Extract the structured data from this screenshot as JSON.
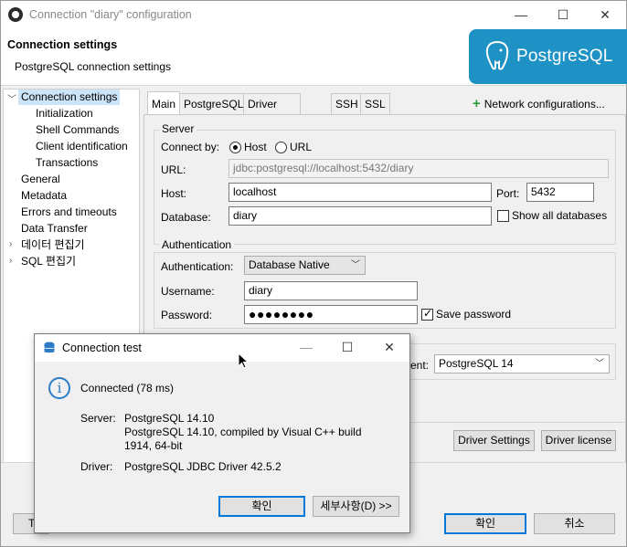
{
  "window": {
    "title": "Connection \"diary\" configuration",
    "minimize": "—",
    "maximize": "☐",
    "close": "✕"
  },
  "header": {
    "title": "Connection settings",
    "subtitle": "PostgreSQL connection settings",
    "logo_text": "PostgreSQL"
  },
  "tree": {
    "items": [
      {
        "label": "Connection settings",
        "expanded": true,
        "selected": true
      },
      {
        "label": "Initialization"
      },
      {
        "label": "Shell Commands"
      },
      {
        "label": "Client identification"
      },
      {
        "label": "Transactions"
      },
      {
        "label": "General"
      },
      {
        "label": "Metadata"
      },
      {
        "label": "Errors and timeouts"
      },
      {
        "label": "Data Transfer"
      },
      {
        "label": "데이터 편집기",
        "collapsed": true
      },
      {
        "label": "SQL 편집기",
        "collapsed": true
      }
    ]
  },
  "tabs": [
    "Main",
    "PostgreSQL",
    "Driver properties",
    "SSH",
    "SSL"
  ],
  "network_config": "Network configurations...",
  "server": {
    "group_label": "Server",
    "connect_by_label": "Connect by:",
    "host_option": "Host",
    "url_option": "URL",
    "url_label": "URL:",
    "url_value": "jdbc:postgresql://localhost:5432/diary",
    "host_label": "Host:",
    "host_value": "localhost",
    "port_label": "Port:",
    "port_value": "5432",
    "database_label": "Database:",
    "database_value": "diary",
    "show_all_label": "Show all databases"
  },
  "auth": {
    "group_label": "Authentication",
    "auth_label": "Authentication:",
    "auth_value": "Database Native",
    "username_label": "Username:",
    "username_value": "diary",
    "password_label": "Password:",
    "password_value": "●●●●●●●●",
    "save_password_label": "Save password"
  },
  "driver": {
    "client_label_fragment": "ent:",
    "client_value": "PostgreSQL 14",
    "settings_button": "Driver Settings",
    "license_button": "Driver license"
  },
  "footer": {
    "test_fragment": "T",
    "ok_button": "확인",
    "cancel_button": "취소"
  },
  "dialog": {
    "title": "Connection test",
    "minimize": "—",
    "maximize": "☐",
    "close": "✕",
    "status": "Connected (78 ms)",
    "server_label": "Server:",
    "server_line1": "PostgreSQL 14.10",
    "server_line2": "PostgreSQL 14.10, compiled by Visual C++ build",
    "server_line3": "1914, 64-bit",
    "driver_label": "Driver:",
    "driver_value": "PostgreSQL JDBC Driver 42.5.2",
    "ok_button": "확인",
    "details_button": "세부사항(D) >>"
  }
}
